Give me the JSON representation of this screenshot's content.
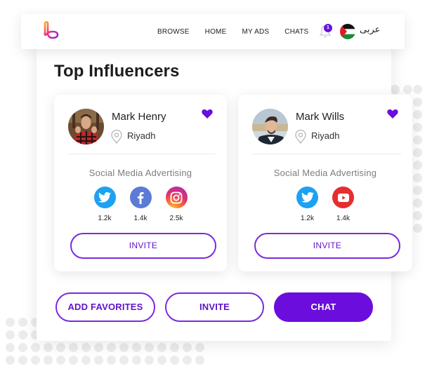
{
  "header": {
    "nav": [
      "BROWSE",
      "HOME",
      "MY ADS",
      "CHATS"
    ],
    "notification_count": "1",
    "language_label": "عربى"
  },
  "page_title": "Top Influencers",
  "influencers": [
    {
      "name": "Mark Henry",
      "location": "Riyadh",
      "favorited": true,
      "category": "Social Media Advertising",
      "socials": [
        {
          "platform": "twitter",
          "count": "1.2k"
        },
        {
          "platform": "facebook",
          "count": "1.4k"
        },
        {
          "platform": "instagram",
          "count": "2.5k"
        }
      ],
      "invite_label": "INVITE"
    },
    {
      "name": "Mark Wills",
      "location": "Riyadh",
      "favorited": true,
      "category": "Social Media Advertising",
      "socials": [
        {
          "platform": "twitter",
          "count": "1.2k"
        },
        {
          "platform": "youtube",
          "count": "1.4k"
        }
      ],
      "invite_label": "INVITE"
    }
  ],
  "actions": {
    "add_favorites": "ADD FAVORITES",
    "invite": "INVITE",
    "chat": "CHAT"
  },
  "colors": {
    "accent": "#6a0ddd",
    "twitter": "#1da1f2",
    "facebook": "#5b7bd5",
    "youtube": "#e62e2e"
  }
}
